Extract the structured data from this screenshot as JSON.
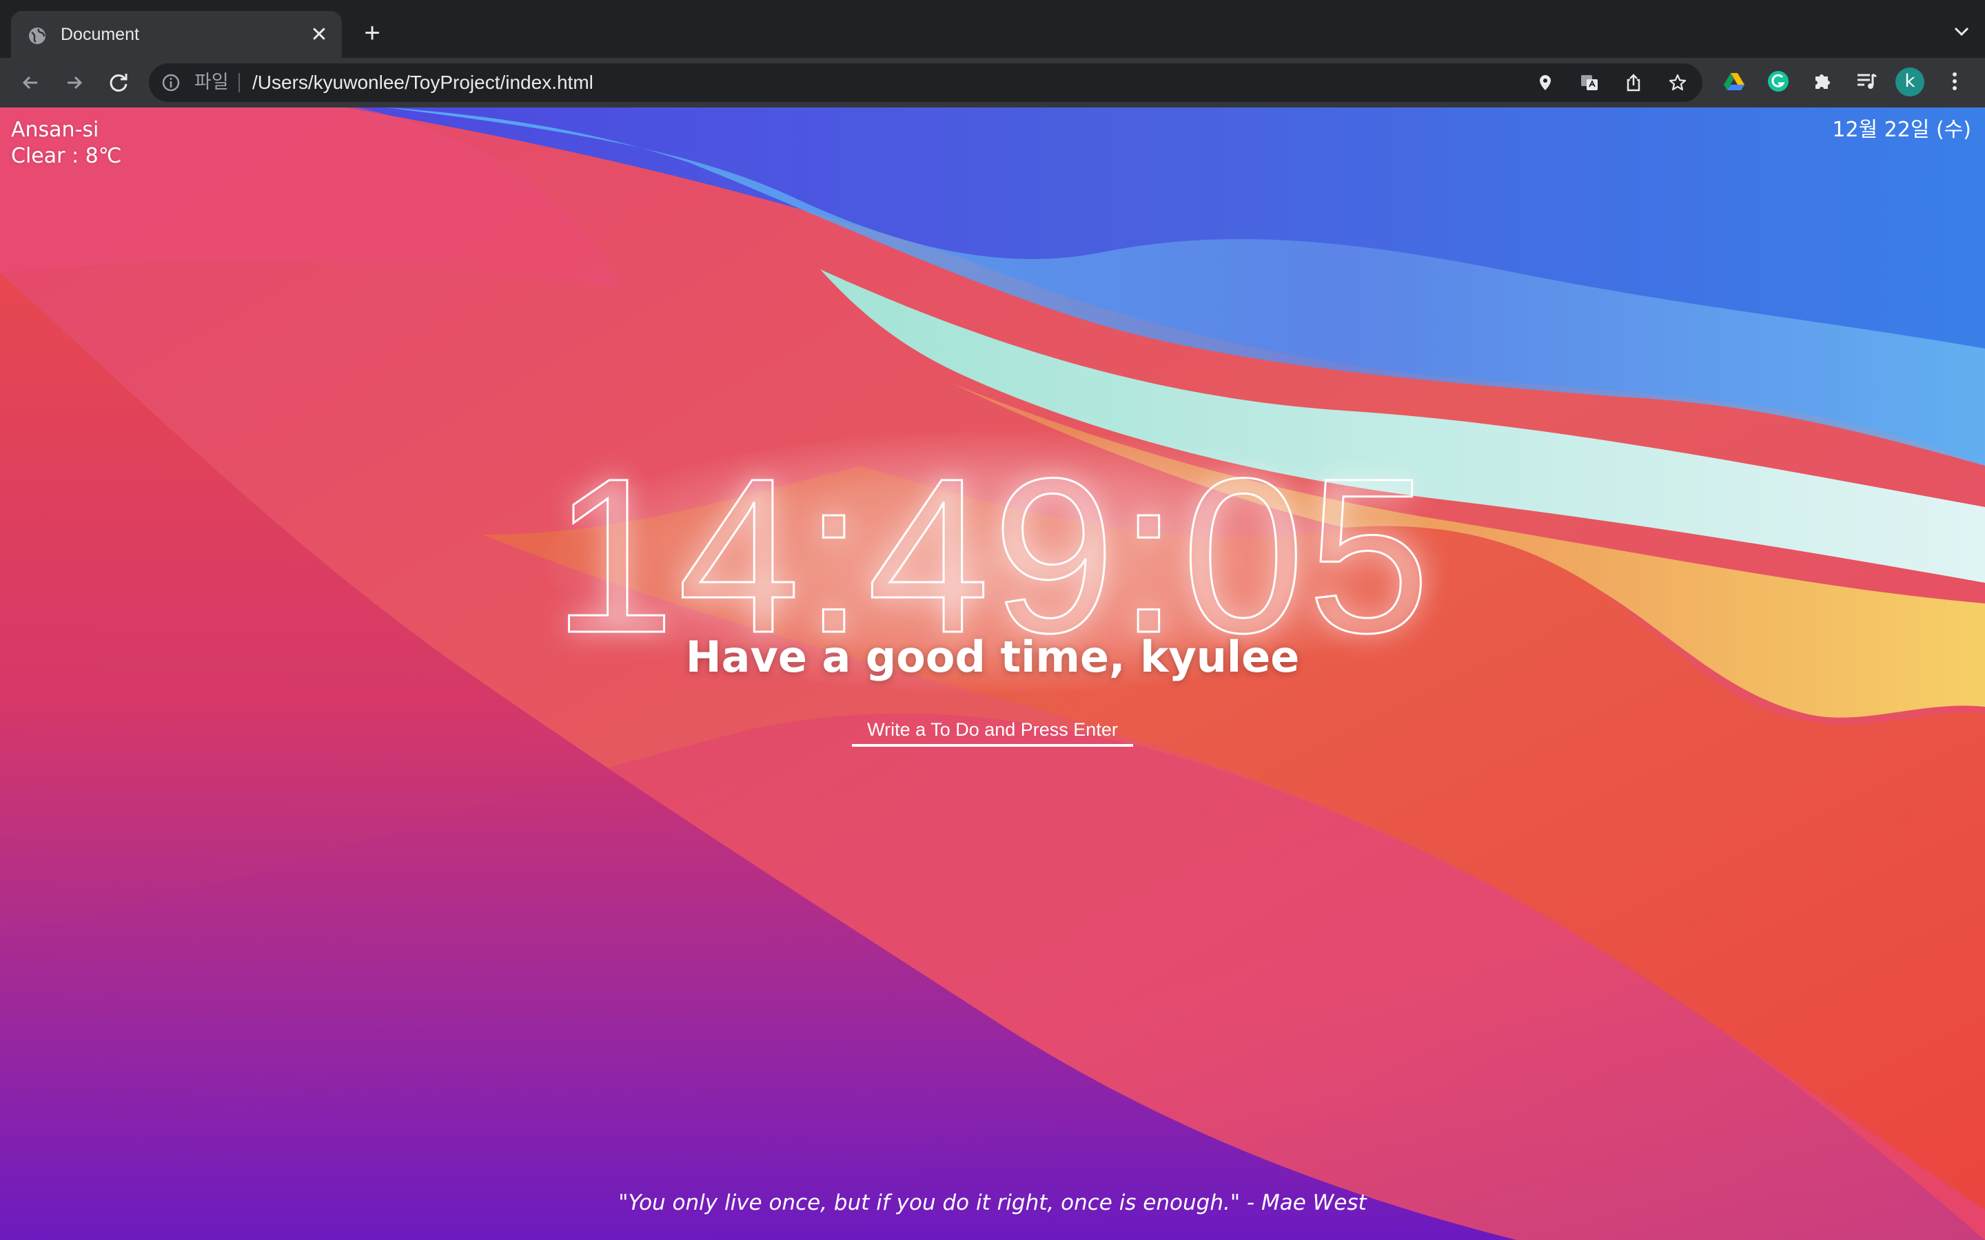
{
  "browser": {
    "tab": {
      "title": "Document",
      "close_symbol": "✕",
      "favicon": "globe-icon"
    },
    "new_tab_symbol": "+",
    "omnibox": {
      "scheme_label": "파일",
      "url": "/Users/kyuwonlee/ToyProject/index.html"
    },
    "profile_initial": "k",
    "colors": {
      "chrome_dark": "#202124",
      "toolbar": "#35363a",
      "avatar": "#1f8f8a"
    },
    "toolbar_icons": [
      "back-arrow-icon",
      "forward-arrow-icon",
      "reload-icon",
      "location-pin-icon",
      "translate-icon",
      "share-icon",
      "star-icon",
      "google-drive-icon",
      "grammarly-icon",
      "extensions-puzzle-icon",
      "reading-list-icon",
      "more-menu-icon"
    ]
  },
  "page": {
    "weather": {
      "city": "Ansan-si",
      "summary": "Clear : 8℃"
    },
    "date": "12월 22일 (수)",
    "clock": "14:49:05",
    "greeting": "Have a good time, kyulee",
    "todo_placeholder": "Write a To Do and Press Enter",
    "quote": "\"You only live once, but if you do it right, once is enough.\" - Mae West"
  }
}
